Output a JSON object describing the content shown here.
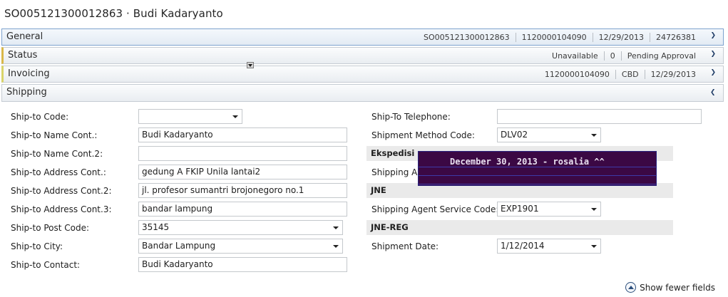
{
  "title": "SO005121300012863 · Budi Kadaryanto",
  "fasttabs": {
    "general": {
      "label": "General",
      "summary": [
        "SO005121300012863",
        "1120000104090",
        "12/29/2013",
        "24726381"
      ]
    },
    "status": {
      "label": "Status",
      "summary": [
        "Unavailable",
        "0",
        "Pending Approval"
      ]
    },
    "invoicing": {
      "label": "Invoicing",
      "summary": [
        "1120000104090",
        "CBD",
        "12/29/2013"
      ]
    },
    "shipping": {
      "label": "Shipping"
    }
  },
  "left_fields": [
    {
      "label": "Ship-to Code:",
      "value": ""
    },
    {
      "label": "Ship-to Name Cont.:",
      "value": "Budi Kadaryanto"
    },
    {
      "label": "Ship-to Name Cont.2:",
      "value": ""
    },
    {
      "label": "Ship-to Address Cont.:",
      "value": "gedung A FKIP Unila lantai2"
    },
    {
      "label": "Ship-to Address Cont.2:",
      "value": "jl. profesor sumantri brojonegoro no.1"
    },
    {
      "label": "Ship-to Address Cont.3:",
      "value": "bandar lampung"
    },
    {
      "label": "Ship-to Post Code:",
      "value": "35145"
    },
    {
      "label": "Ship-to City:",
      "value": "Bandar Lampung"
    },
    {
      "label": "Ship-to Contact:",
      "value": "Budi Kadaryanto"
    }
  ],
  "right_fields": {
    "telephone": {
      "label": "Ship-To Telephone:",
      "value": ""
    },
    "shipment_method": {
      "label": "Shipment Method Code:",
      "value": "DLV02"
    },
    "ekspedisi": "Ekspedisi",
    "shipping_agent": {
      "label": "Shipping Ag"
    },
    "jne": "JNE",
    "agent_service": {
      "label": "Shipping Agent Service Code:",
      "value": "EXP1901"
    },
    "jne_reg": "JNE-REG",
    "shipment_date": {
      "label": "Shipment Date:",
      "value": "1/12/2014"
    }
  },
  "overlay_text": "December 30, 2013 - rosalia ^^",
  "show_fewer": "Show fewer fields",
  "icons": {
    "collapse": "chevron-down-icon",
    "expand": "chevron-up-icon"
  }
}
